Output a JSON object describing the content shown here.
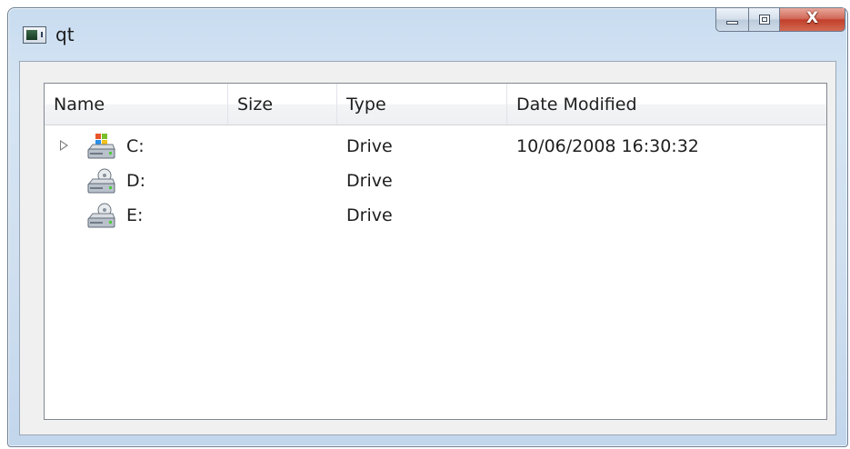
{
  "window": {
    "title": "qt",
    "close_glyph": "X"
  },
  "tree": {
    "columns": [
      "Name",
      "Size",
      "Type",
      "Date Modified"
    ],
    "rows": [
      {
        "name": "C:",
        "size": "",
        "type": "Drive",
        "date_modified": "10/06/2008 16:30:32",
        "icon": "windows-drive-icon",
        "expandable": true
      },
      {
        "name": "D:",
        "size": "",
        "type": "Drive",
        "date_modified": "",
        "icon": "drive-icon",
        "expandable": false
      },
      {
        "name": "E:",
        "size": "",
        "type": "Drive",
        "date_modified": "",
        "icon": "drive-icon",
        "expandable": false
      }
    ]
  },
  "colors": {
    "frame": "#cfdff0",
    "close_button": "#c13f2b",
    "view_background": "#ffffff"
  }
}
